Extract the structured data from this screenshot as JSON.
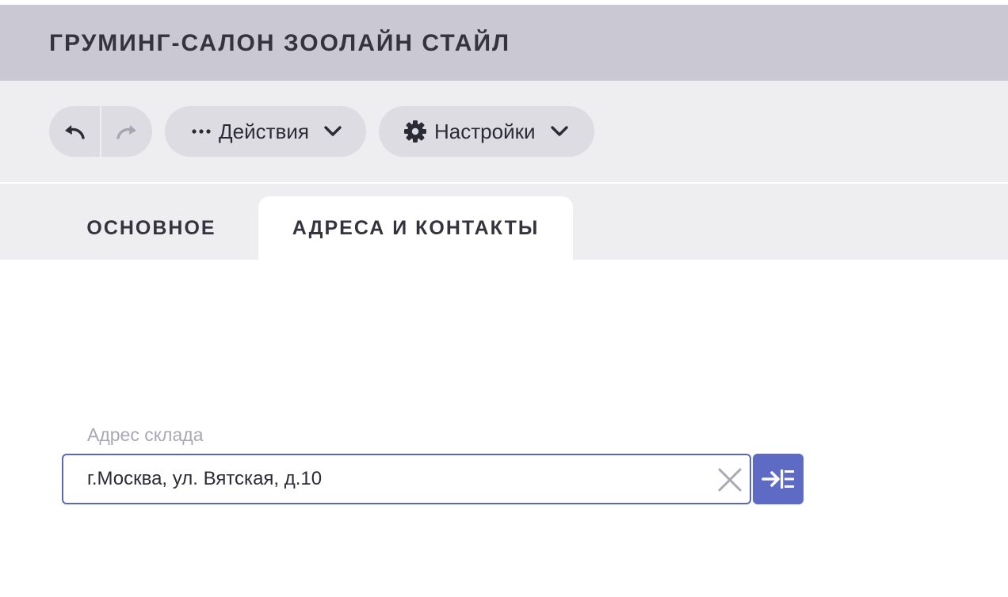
{
  "header": {
    "title": "ГРУМИНГ-САЛОН ЗООЛАЙН СТАЙЛ"
  },
  "toolbar": {
    "undo_icon": "undo-icon",
    "redo_icon": "redo-icon",
    "actions_label": "Действия",
    "actions_icon": "ellipsis-icon",
    "settings_label": "Настройки",
    "settings_icon": "gear-icon"
  },
  "tabs": [
    {
      "label": "ОСНОВНОЕ",
      "active": false
    },
    {
      "label": "АДРЕСА И КОНТАКТЫ",
      "active": true
    }
  ],
  "form": {
    "warehouse_address": {
      "label": "Адрес склада",
      "value": "г.Москва, ул. Вятская, д.10"
    }
  },
  "colors": {
    "accent": "#5d6bc4",
    "header_bg": "#c9c8d3",
    "toolbar_bg": "#eeeef1",
    "pill_bg": "#dddce3",
    "muted_text": "#a9a8b3"
  }
}
